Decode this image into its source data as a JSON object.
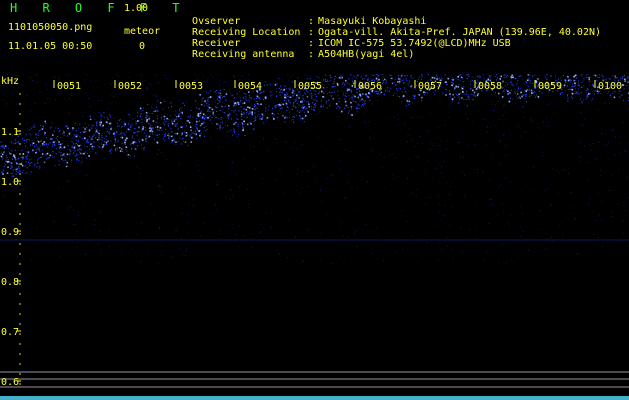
{
  "header": {
    "app_title": "H R O F F T",
    "app_version": "1.00",
    "filename": "1101050050.png",
    "datetime": "11.01.05 00:50",
    "meteor_label": "meteor",
    "meteor_count": "0"
  },
  "info": [
    {
      "label": "Ovserver",
      "sep": ":",
      "value": "Masayuki Kobayashi"
    },
    {
      "label": "Receiving Location",
      "sep": ":",
      "value": "Ogata-vill. Akita-Pref. JAPAN (139.96E, 40.02N)"
    },
    {
      "label": "Receiver",
      "sep": ":",
      "value": "ICOM IC-575 53.7492(@LCD)MHz USB"
    },
    {
      "label": "Receiving antenna",
      "sep": ":",
      "value": "A504HB(yagi 4el)"
    }
  ],
  "spectrogram": {
    "unit_label": "kHz",
    "time_ticks": [
      "0051",
      "0052",
      "0053",
      "0054",
      "0055",
      "0056",
      "0057",
      "0058",
      "0059",
      "0100"
    ],
    "freq_ticks": [
      "1.1",
      "1.0",
      "0.9",
      "0.8",
      "0.7",
      "0.6"
    ],
    "colors": {
      "background": "#000000",
      "signal": "#2a45ff",
      "signal_bright": "#9fb8ff",
      "tick_text": "#ffff33",
      "header_text": "#ffff33",
      "title_text": "#22ff22",
      "grid_lines": "#c8c8c8",
      "bottom_bar": "#55ddff"
    }
  }
}
